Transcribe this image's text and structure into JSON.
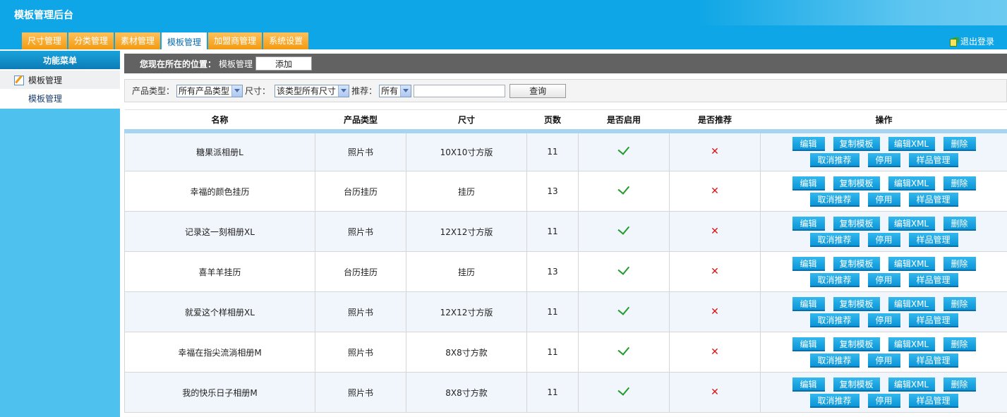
{
  "app": {
    "title": "模板管理后台",
    "logout": "退出登录"
  },
  "nav": {
    "tabs": [
      "尺寸管理",
      "分类管理",
      "素材管理",
      "模板管理",
      "加盟商管理",
      "系统设置"
    ],
    "active_index": 3
  },
  "sidebar": {
    "title": "功能菜单",
    "group": "模板管理",
    "item": "模板管理"
  },
  "breadcrumb": {
    "label": "您现在所在的位置：",
    "current": "模板管理",
    "add_button": "添加"
  },
  "filters": {
    "product_type_label": "产品类型：",
    "product_type_value": "所有产品类型",
    "size_label": "尺寸：",
    "size_value": "该类型所有尺寸",
    "recommend_label": "推荐：",
    "recommend_value": "所有",
    "keyword_value": "",
    "query_button": "查询"
  },
  "table": {
    "headers": [
      "名称",
      "产品类型",
      "尺寸",
      "页数",
      "是否启用",
      "是否推荐",
      "操作"
    ],
    "actions": {
      "edit": "编辑",
      "copy": "复制模板",
      "edit_xml": "编辑XML",
      "delete": "删除",
      "unrecommend": "取消推荐",
      "disable": "停用",
      "samples": "样品管理"
    },
    "rows": [
      {
        "name": "糖果派相册L",
        "type": "照片书",
        "size": "10X10寸方版",
        "pages": "11",
        "enabled": true,
        "recommended": false
      },
      {
        "name": "幸福的颜色挂历",
        "type": "台历挂历",
        "size": "挂历",
        "pages": "13",
        "enabled": true,
        "recommended": false
      },
      {
        "name": "记录这一刻相册XL",
        "type": "照片书",
        "size": "12X12寸方版",
        "pages": "11",
        "enabled": true,
        "recommended": false
      },
      {
        "name": "喜羊羊挂历",
        "type": "台历挂历",
        "size": "挂历",
        "pages": "13",
        "enabled": true,
        "recommended": false
      },
      {
        "name": "就爱这个样相册XL",
        "type": "照片书",
        "size": "12X12寸方版",
        "pages": "11",
        "enabled": true,
        "recommended": false
      },
      {
        "name": "幸福在指尖流淌相册M",
        "type": "照片书",
        "size": "8X8寸方款",
        "pages": "11",
        "enabled": true,
        "recommended": false
      },
      {
        "name": "我的快乐日子相册M",
        "type": "照片书",
        "size": "8X8寸方款",
        "pages": "11",
        "enabled": true,
        "recommended": false
      }
    ]
  },
  "colors": {
    "header_blue": "#0ea6e6",
    "tab_orange": "#f39a10",
    "sidebar_blue": "#4fc1ef",
    "action_blue": "#0c96d8",
    "check_green": "#229b2d",
    "cross_red": "#dd1111"
  }
}
